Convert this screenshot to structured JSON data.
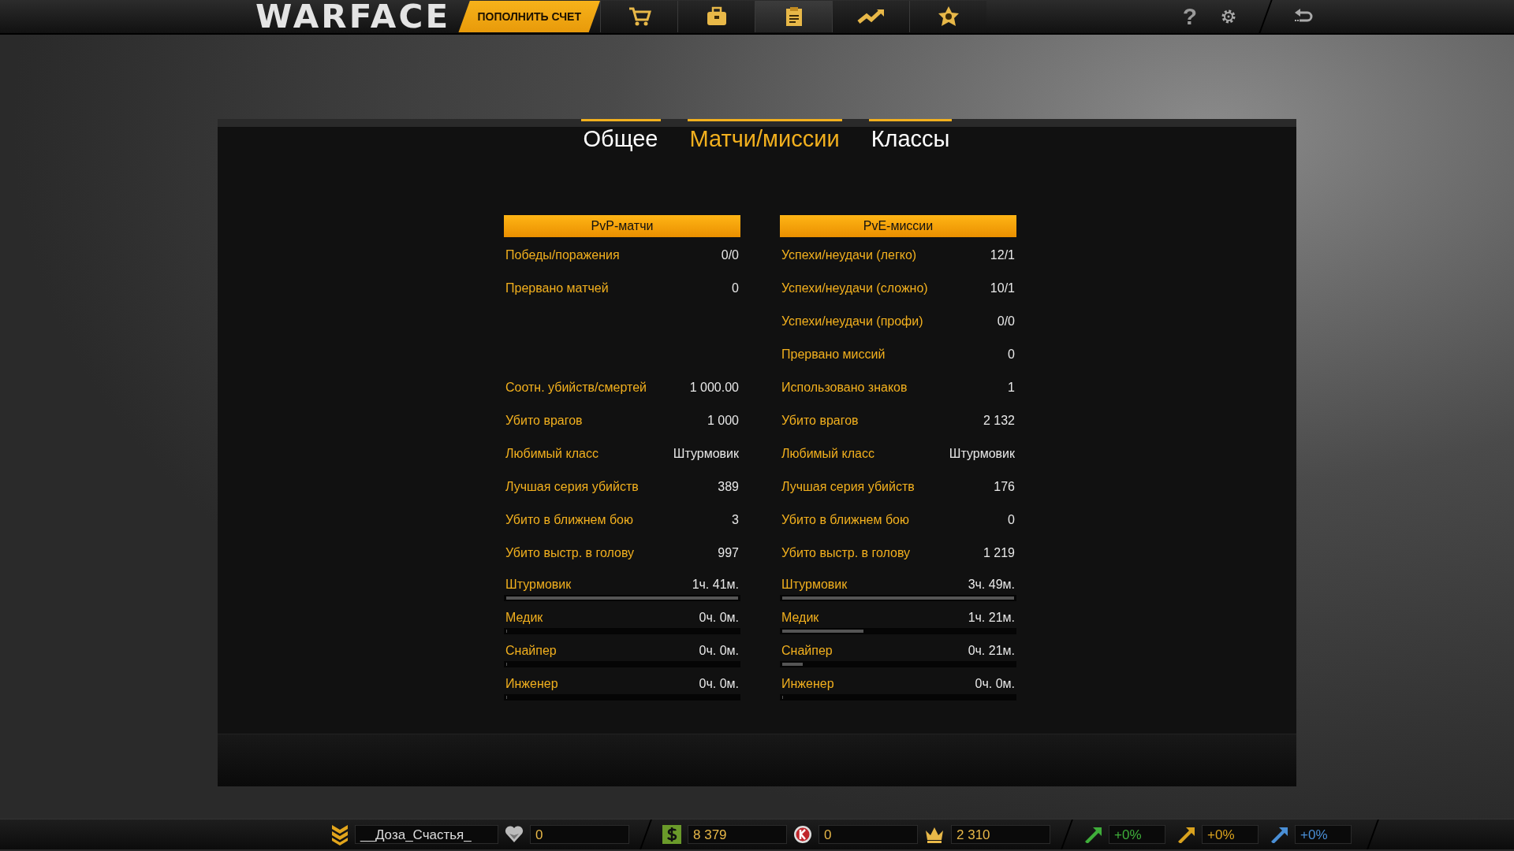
{
  "top_bar": {
    "logo": "WARFACE",
    "topup_button": "ПОПОЛНИТЬ СЧЕТ",
    "nav": [
      {
        "kind": "cart",
        "selected": false
      },
      {
        "kind": "chest",
        "selected": false
      },
      {
        "kind": "clipboard",
        "selected": true
      },
      {
        "kind": "chart",
        "selected": false
      },
      {
        "kind": "badge",
        "selected": false
      }
    ],
    "help": "?"
  },
  "tabs": [
    {
      "label": "Общее",
      "selected": false
    },
    {
      "label": "Матчи/миссии",
      "selected": true
    },
    {
      "label": "Классы",
      "selected": false
    }
  ],
  "columns": [
    {
      "title": "PvP-матчи",
      "results": [
        {
          "label": "Победы/поражения",
          "value": "0/0"
        },
        {
          "label": "Прервано матчей",
          "value": "0"
        }
      ],
      "stats": [
        {
          "label": "Соотн. убийств/смертей",
          "value": "1 000.00"
        },
        {
          "label": "Убито врагов",
          "value": "1 000"
        },
        {
          "label": "Любимый класс",
          "value": "Штурмовик"
        },
        {
          "label": "Лучшая серия убийств",
          "value": "389"
        },
        {
          "label": "Убито в ближнем бою",
          "value": "3"
        },
        {
          "label": "Убито выстр. в голову",
          "value": "997"
        }
      ],
      "classes": [
        {
          "label": "Штурмовик",
          "value": "1ч. 41м.",
          "level": 1
        },
        {
          "label": "Медик",
          "value": "0ч. 0м.",
          "level": 0
        },
        {
          "label": "Снайпер",
          "value": "0ч. 0м.",
          "level": 0
        },
        {
          "label": "Инженер",
          "value": "0ч. 0м.",
          "level": 0
        }
      ]
    },
    {
      "title": "PvE-миссии",
      "results": [
        {
          "label": "Успехи/неудачи (легко)",
          "value": "12/1"
        },
        {
          "label": "Успехи/неудачи (сложно)",
          "value": "10/1"
        },
        {
          "label": "Успехи/неудачи (профи)",
          "value": "0/0"
        },
        {
          "label": "Прервано миссий",
          "value": "0"
        }
      ],
      "stats": [
        {
          "label": "Использовано знаков",
          "value": "1"
        },
        {
          "label": "Убито врагов",
          "value": "2 132"
        },
        {
          "label": "Любимый класс",
          "value": "Штурмовик"
        },
        {
          "label": "Лучшая серия убийств",
          "value": "176"
        },
        {
          "label": "Убито в ближнем бою",
          "value": "0"
        },
        {
          "label": "Убито выстр. в голову",
          "value": "1 219"
        }
      ],
      "classes": [
        {
          "label": "Штурмовик",
          "value": "3ч. 49м.",
          "level": 1
        },
        {
          "label": "Медик",
          "value": "1ч. 21м.",
          "level": 0.35
        },
        {
          "label": "Снайпер",
          "value": "0ч. 21м.",
          "level": 0.09
        },
        {
          "label": "Инженер",
          "value": "0ч. 0м.",
          "level": 0
        }
      ]
    }
  ],
  "status_bar": {
    "player_name": "__Доза_Счастья_",
    "currencies": [
      {
        "kind": "heart",
        "value": "0"
      },
      {
        "kind": "dollar",
        "value": "8 379"
      },
      {
        "kind": "k",
        "value": "0"
      },
      {
        "kind": "crown",
        "value": "2 310"
      }
    ],
    "boosters": [
      {
        "value": "+0%",
        "color": "#3fae3a"
      },
      {
        "value": "+0%",
        "color": "#d9a21e"
      },
      {
        "value": "+0%",
        "color": "#4a8fd6"
      }
    ]
  }
}
